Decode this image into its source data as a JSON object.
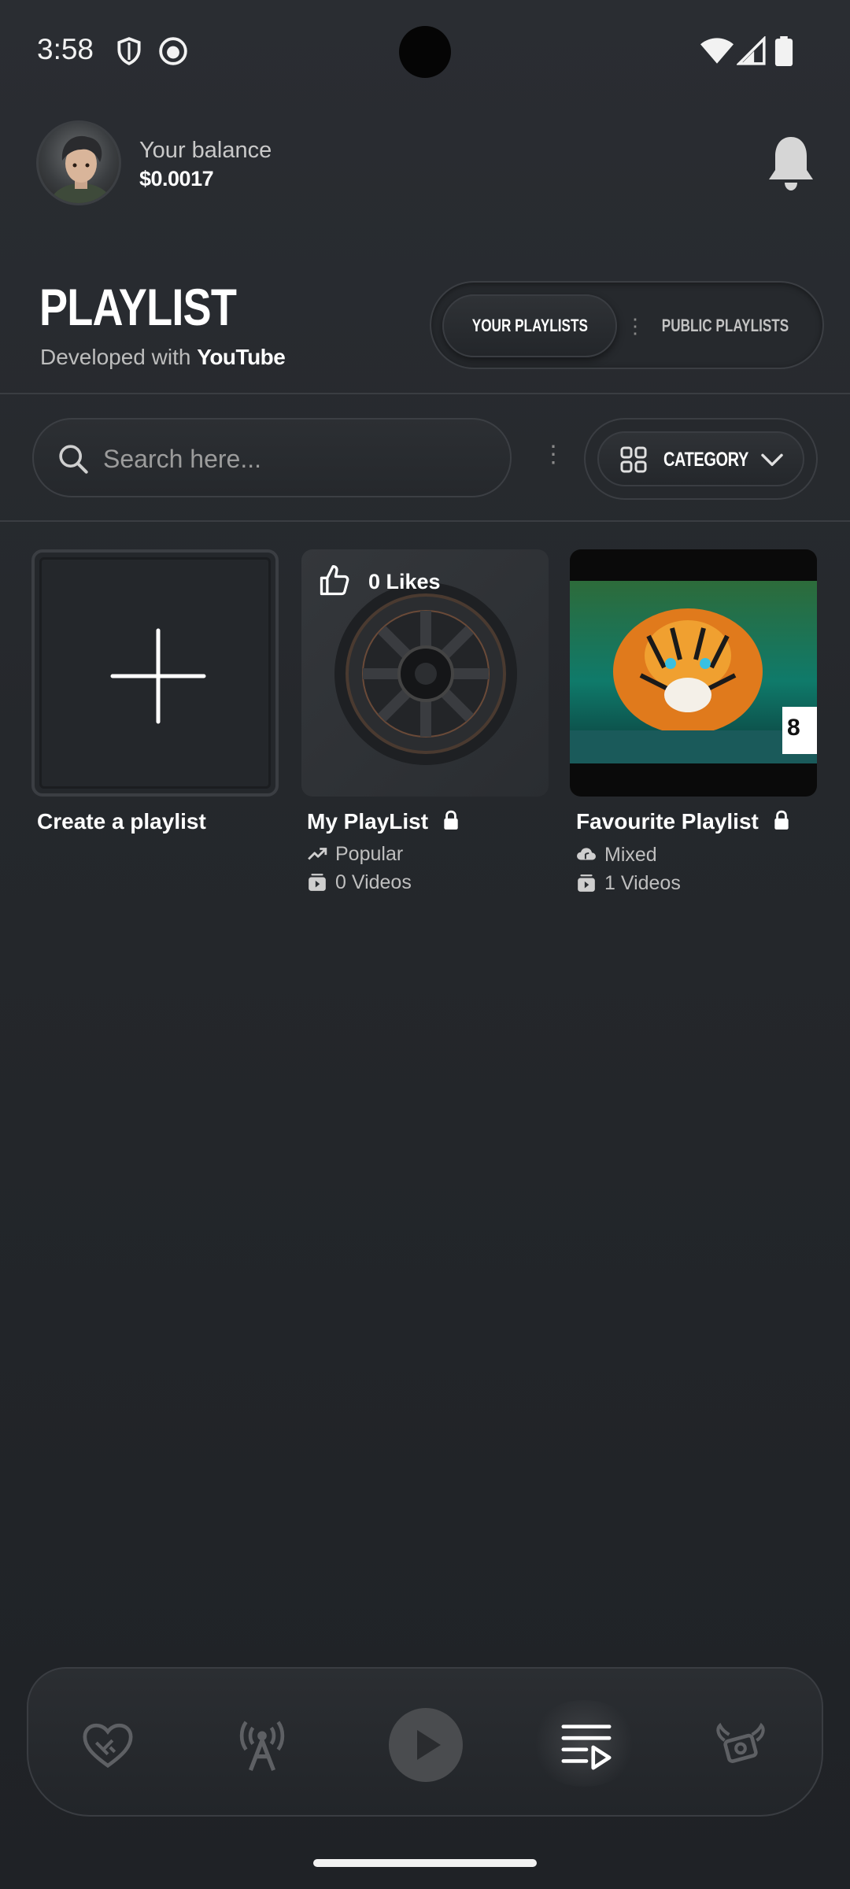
{
  "status_bar": {
    "time": "3:58"
  },
  "header": {
    "balance_label": "Your balance",
    "balance_value": "$0.0017"
  },
  "page": {
    "title": "PLAYLIST",
    "subtitle_prefix": "Developed with",
    "subtitle_brand": "YouTube"
  },
  "tabs": [
    {
      "label": "YOUR PLAYLISTS",
      "active": true
    },
    {
      "label": "PUBLIC PLAYLISTS",
      "active": false
    }
  ],
  "search": {
    "placeholder": "Search here..."
  },
  "category": {
    "label": "CATEGORY"
  },
  "cards": [
    {
      "title": "Create a playlist"
    },
    {
      "title": "My PlayList",
      "likes": "0 Likes",
      "tag": "Popular",
      "videos": "0 Videos",
      "locked": true
    },
    {
      "title": "Favourite Playlist",
      "tag": "Mixed",
      "videos": "1 Videos",
      "locked": true
    }
  ],
  "nav": {
    "items": [
      "handshake-heart-icon",
      "broadcast-tower-icon",
      "play-icon",
      "playlist-icon",
      "angel-money-icon"
    ],
    "active": "playlist-icon"
  },
  "colors": {
    "background": "#25282c",
    "surface": "#2c2f33",
    "border": "#3b3e43",
    "text_primary": "#ffffff",
    "text_secondary": "#bfbfbf"
  }
}
